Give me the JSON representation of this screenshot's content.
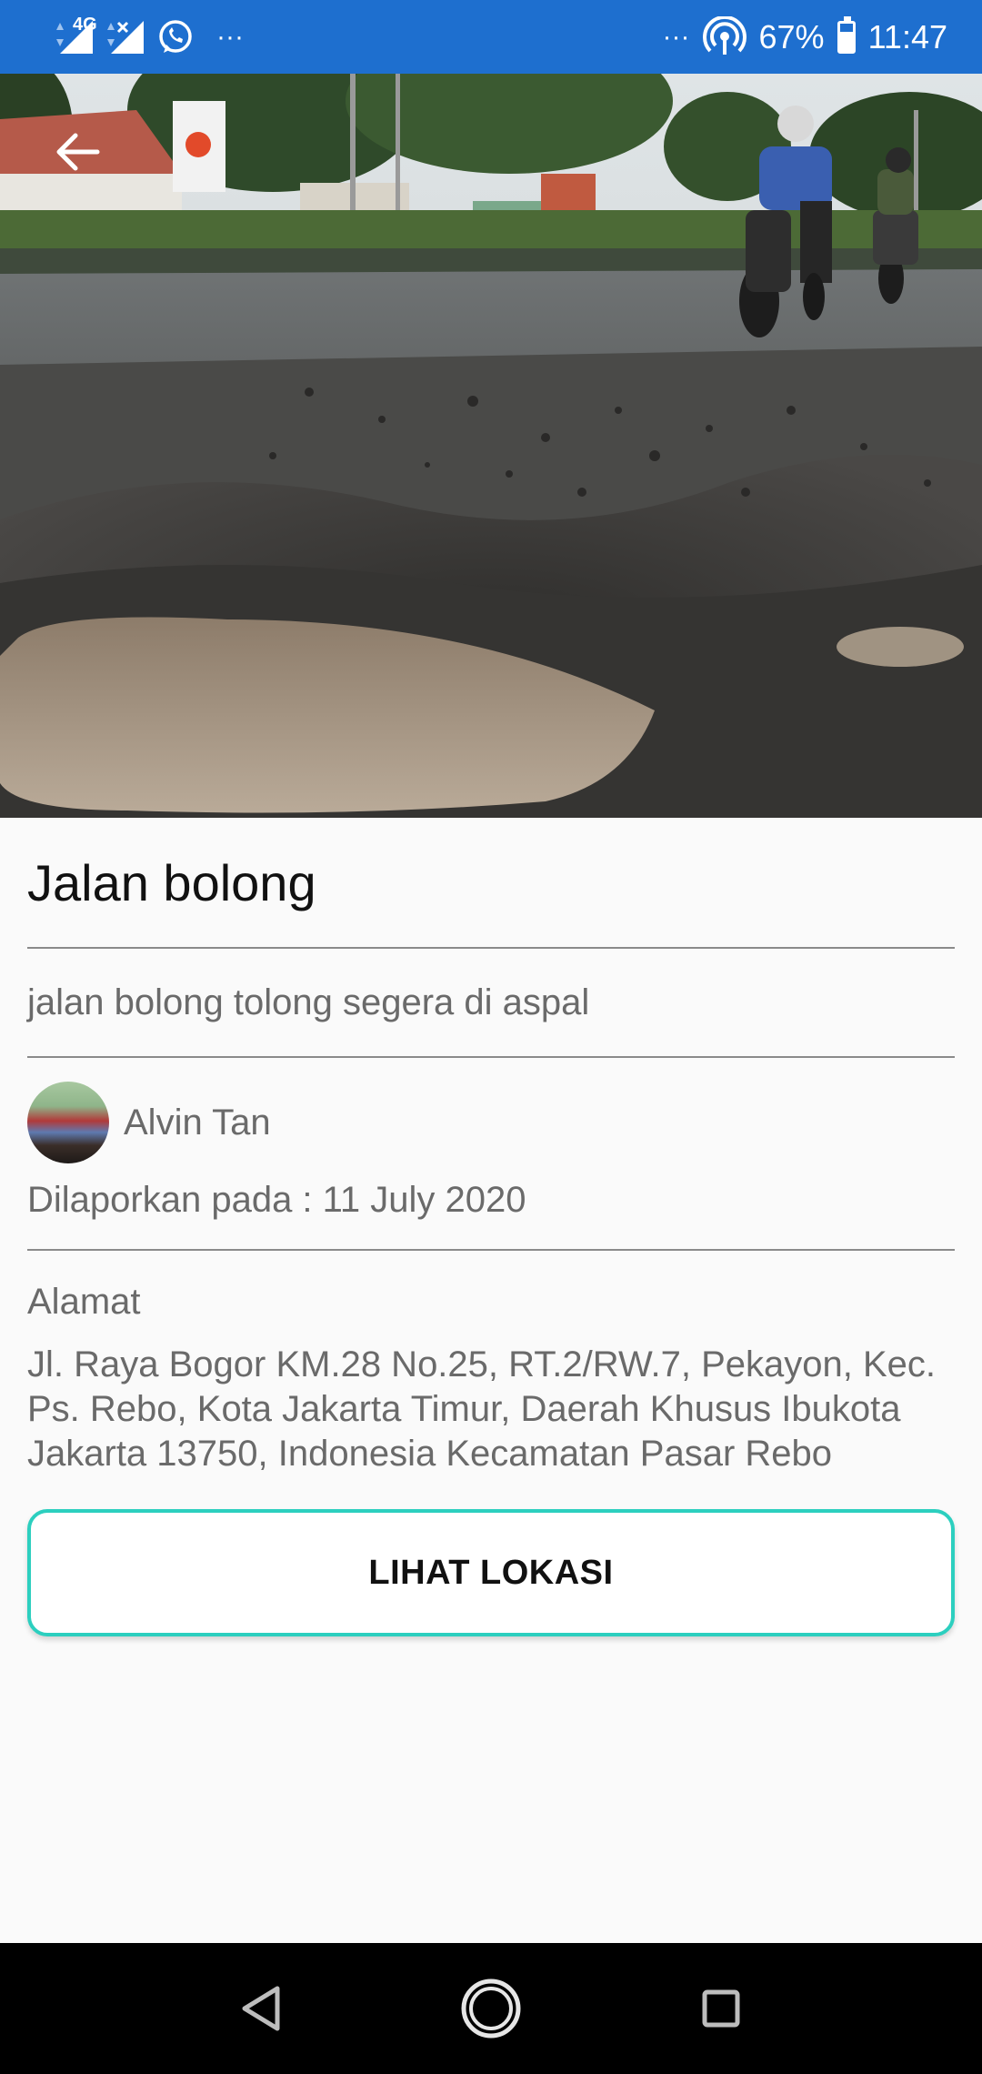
{
  "status_bar": {
    "network": "4G",
    "battery": "67%",
    "battery_level": 0.67,
    "time": "11:47",
    "overflow_left": "···",
    "overflow_right": "···"
  },
  "report": {
    "title": "Jalan bolong",
    "description": "jalan bolong tolong segera di aspal",
    "reporter_name": "Alvin Tan",
    "reported_at": "Dilaporkan pada : 11 July 2020",
    "address_label": "Alamat",
    "address": "Jl. Raya Bogor KM.28 No.25, RT.2/RW.7, Pekayon, Kec. Ps. Rebo, Kota Jakarta Timur, Daerah Khusus Ibukota Jakarta 13750, Indonesia Kecamatan Pasar Rebo",
    "view_location_label": "LIHAT LOKASI"
  },
  "colors": {
    "status_bar": "#1e6fcf",
    "button_border": "#2ccfbf"
  },
  "icons": {
    "back": "arrow-left-icon",
    "nav_back": "triangle-back-icon",
    "nav_home": "circle-home-icon",
    "nav_recents": "square-recents-icon"
  }
}
